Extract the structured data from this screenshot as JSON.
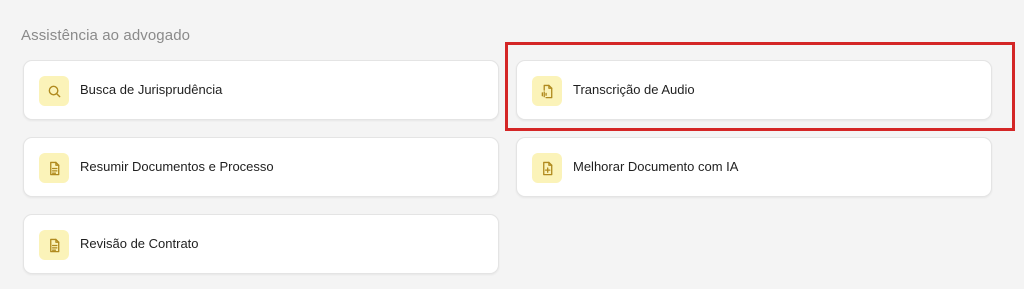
{
  "section": {
    "title": "Assistência ao advogado"
  },
  "cards": [
    {
      "label": "Busca de Jurisprudência",
      "icon": "search-icon"
    },
    {
      "label": "Resumir Documentos e Processo",
      "icon": "document-icon"
    },
    {
      "label": "Revisão de Contrato",
      "icon": "document-icon"
    },
    {
      "label": "Transcrição de Audio",
      "icon": "audio-file-icon"
    },
    {
      "label": "Melhorar Documento com IA",
      "icon": "document-plus-icon"
    }
  ],
  "colors": {
    "background": "#f4f4f4",
    "card_background": "#ffffff",
    "icon_background": "#fbf3b9",
    "icon_stroke": "#b08a1e",
    "section_title": "#8a8a8a",
    "highlight": "#d42626"
  }
}
